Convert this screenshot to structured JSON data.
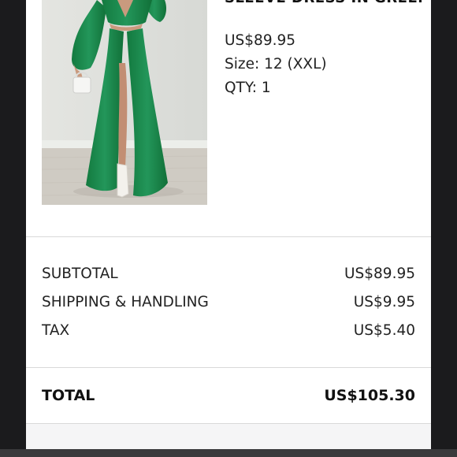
{
  "product": {
    "title": "SLEEVE DRESS IN GREEN",
    "price": "US$89.95",
    "size": "Size: 12 (XXL)",
    "qty": "QTY: 1",
    "image_description_icon": "green-dress-photo"
  },
  "summary": {
    "subtotal_label": "SUBTOTAL",
    "subtotal_value": "US$89.95",
    "shipping_label": "SHIPPING & HANDLING",
    "shipping_value": "US$9.95",
    "tax_label": "TAX",
    "tax_value": "US$5.40",
    "total_label": "TOTAL",
    "total_value": "US$105.30"
  },
  "colors": {
    "dress_green": "#1f8a4c",
    "background_dark": "#1b1b1d",
    "card": "#ffffff"
  }
}
